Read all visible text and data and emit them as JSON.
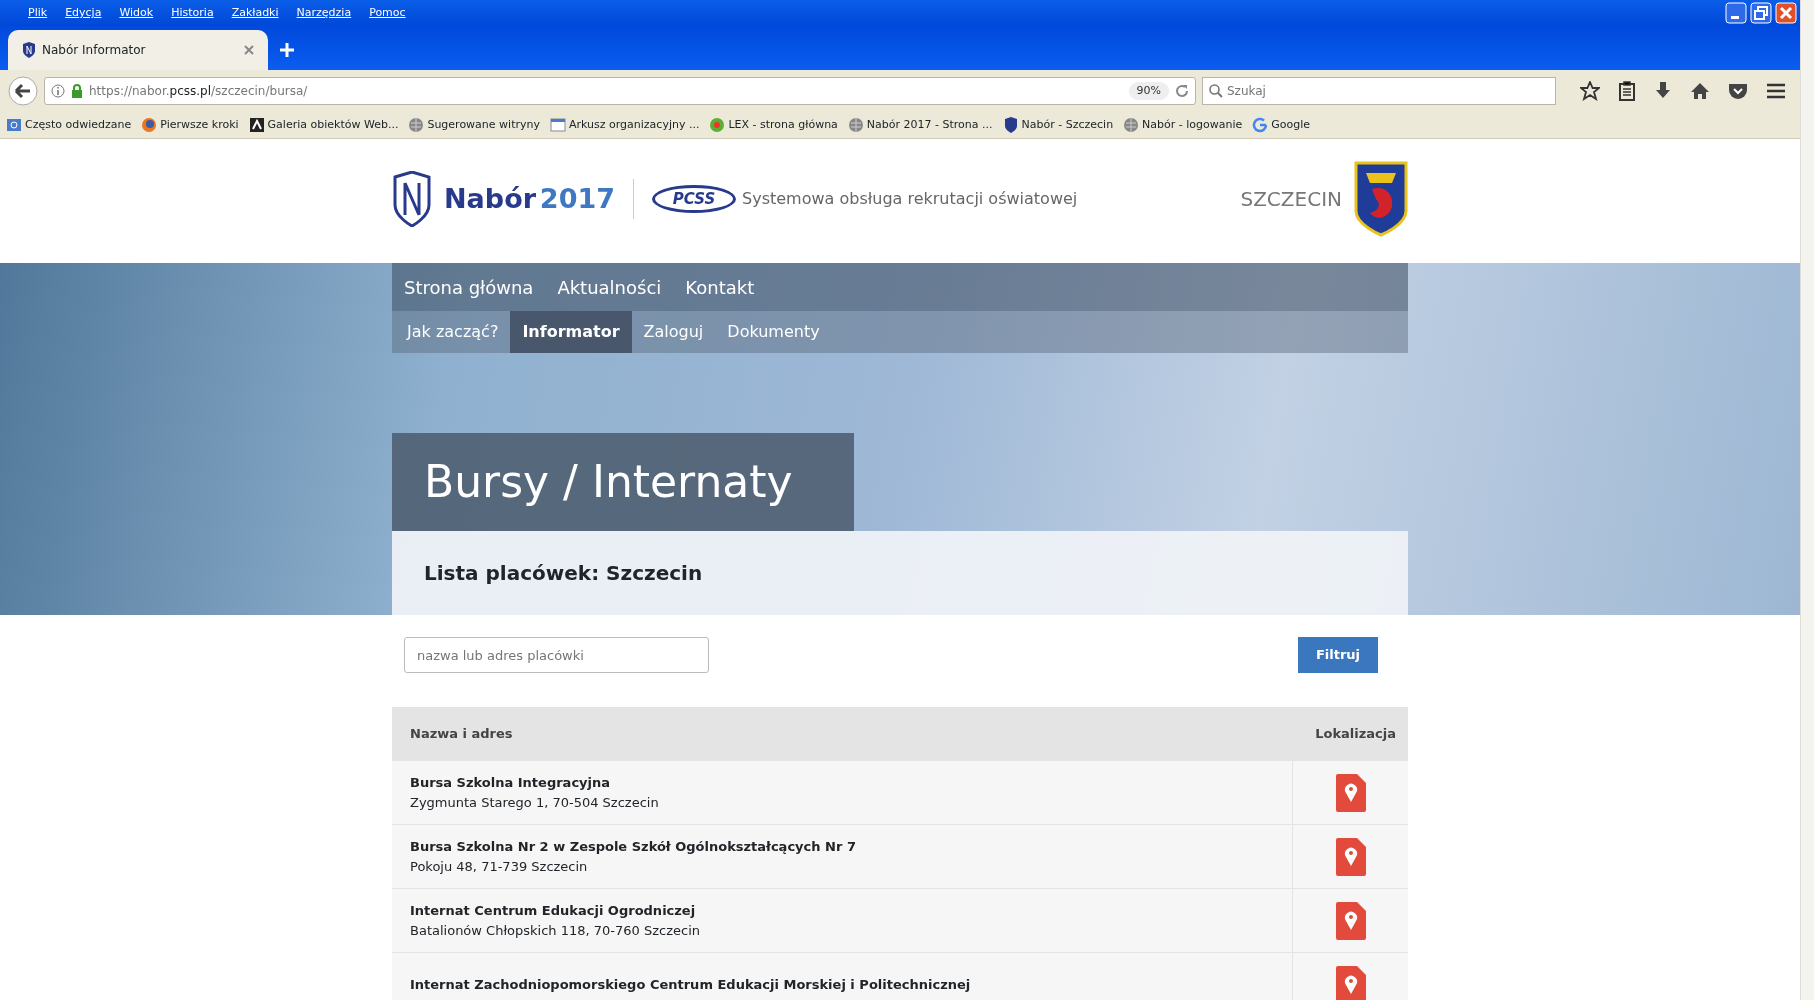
{
  "window": {
    "menu": [
      "Plik",
      "Edycja",
      "Widok",
      "Historia",
      "Zakładki",
      "Narzędzia",
      "Pomoc"
    ],
    "tabs": [
      {
        "title": "Nabór Informator",
        "selected": true
      }
    ],
    "address": "https://nabor.**pcss.pl**/szczecin/bursa/",
    "zoom": "90%",
    "search": {
      "placeholder": "Szukaj"
    },
    "bookmarks": [
      {
        "label": "Często odwiedzane",
        "kind": "folder"
      },
      {
        "label": "Pierwsze kroki",
        "kind": "fox"
      },
      {
        "label": "Galeria obiektów Web...",
        "kind": "gallery"
      },
      {
        "label": "Sugerowane witryny",
        "kind": "globe"
      },
      {
        "label": "Arkusz organizacyjny ...",
        "kind": "sheet"
      },
      {
        "label": "LEX - strona główna",
        "kind": "lex"
      },
      {
        "label": "Nabór 2017 - Strona ...",
        "kind": "globe"
      },
      {
        "label": "Nabór - Szczecin",
        "kind": "shield"
      },
      {
        "label": "Nabór - logowanie",
        "kind": "globe"
      },
      {
        "label": "Google",
        "kind": "google"
      }
    ]
  },
  "page": {
    "brand_name": "Nabór",
    "brand_year": "2017",
    "partner_logo": "PCSS",
    "tagline": "Systemowa obsługa rekrutacji oświatowej",
    "city": "SZCZECIN",
    "nav_main": [
      "Strona główna",
      "Aktualności",
      "Kontakt"
    ],
    "nav_sub": [
      {
        "label": "Jak zacząć?",
        "selected": false
      },
      {
        "label": "Informator",
        "selected": true
      },
      {
        "label": "Zaloguj",
        "selected": false
      },
      {
        "label": "Dokumenty",
        "selected": false
      }
    ],
    "title": "Bursy / Internaty",
    "subtitle": "Lista placówek: Szczecin",
    "filter": {
      "placeholder": "nazwa lub adres placówki",
      "button": "Filtruj"
    },
    "table": {
      "columns": [
        "Nazwa i adres",
        "Lokalizacja"
      ],
      "rows": [
        {
          "name": "Bursa Szkolna Integracyjna",
          "address": "Zygmunta Starego 1, 70-504 Szczecin"
        },
        {
          "name": "Bursa Szkolna Nr 2 w Zespole Szkół Ogólnokształcących Nr 7",
          "address": "Pokoju 48, 71-739 Szczecin"
        },
        {
          "name": "Internat Centrum Edukacji Ogrodniczej",
          "address": "Batalionów Chłopskich 118, 70-760 Szczecin"
        },
        {
          "name": "Internat Zachodniopomorskiego Centrum Edukacji Morskiej i Politechnicznej"
        }
      ]
    }
  }
}
